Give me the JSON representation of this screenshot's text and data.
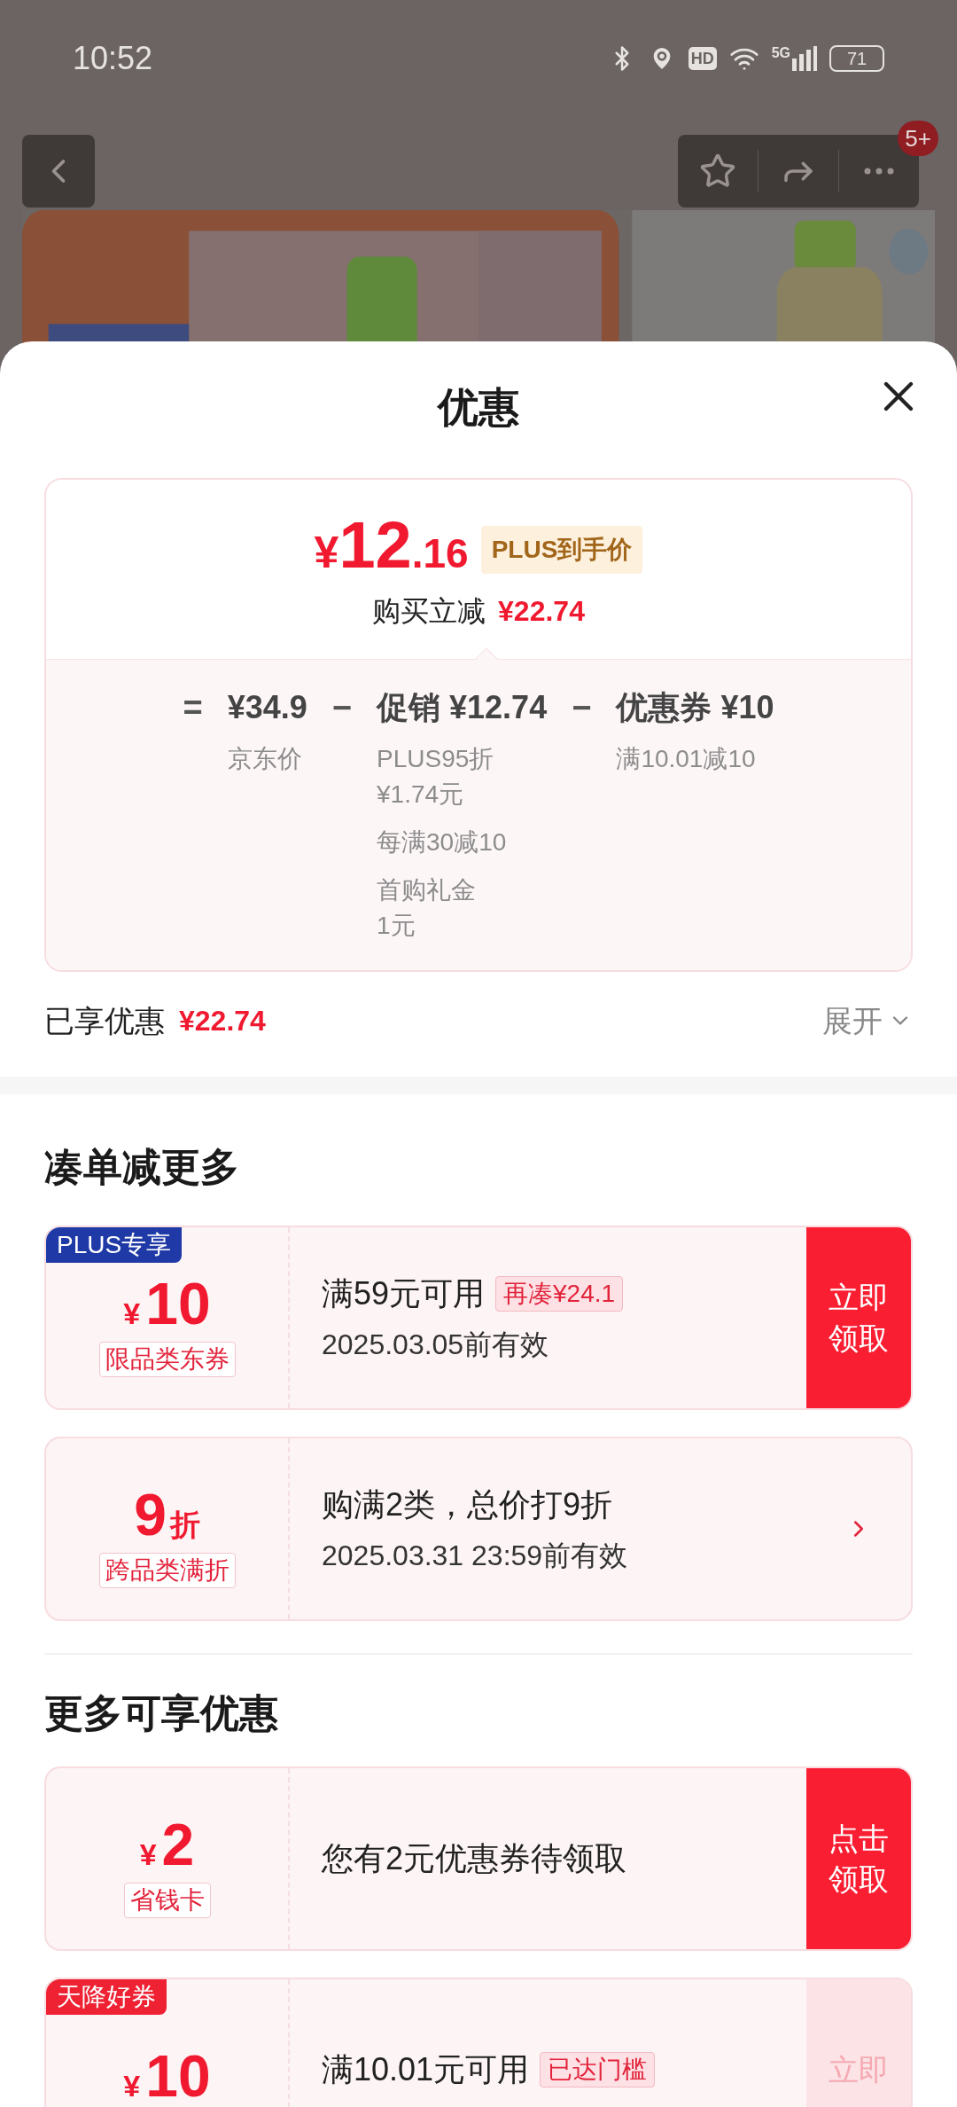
{
  "status_bar": {
    "time": "10:52",
    "hd": "HD",
    "network": "5G",
    "battery": "71"
  },
  "nav": {
    "badge": "5+"
  },
  "sheet": {
    "title": "优惠"
  },
  "price_card": {
    "symbol": "¥",
    "price_int": "12",
    "price_dec": ".16",
    "badge": "PLUS到手价",
    "instant_label": "购买立减",
    "instant_amount": "¥22.74",
    "breakdown": [
      {
        "operator": "=",
        "label": "¥34.9",
        "notes": [
          {
            "lines": [
              "京东价"
            ]
          }
        ]
      },
      {
        "operator": "−",
        "label": "促销 ¥12.74",
        "notes": [
          {
            "lines": [
              "PLUS95折",
              "¥1.74元"
            ]
          },
          {
            "lines": [
              "每满30减10"
            ]
          },
          {
            "lines": [
              "首购礼金",
              "1元"
            ]
          }
        ]
      },
      {
        "operator": "−",
        "label": "优惠券 ¥10",
        "notes": [
          {
            "lines": [
              "满10.01减10"
            ]
          }
        ]
      }
    ]
  },
  "summary": {
    "label": "已享优惠",
    "amount": "¥22.74",
    "expand": "展开"
  },
  "sections": [
    {
      "title": "凑单减更多",
      "coupons": [
        {
          "kind": "button",
          "tag": {
            "text": "PLUS专享",
            "color": "#1f3aa6"
          },
          "symbol": "¥",
          "amount": "10",
          "type": "限品类东券",
          "condition": "满59元可用",
          "hint": "再凑¥24.1",
          "validity": "2025.03.05前有效",
          "button_lines": [
            "立即",
            "领取"
          ],
          "disabled": false
        },
        {
          "kind": "arrow",
          "amount": "9",
          "unit": "折",
          "type": "跨品类满折",
          "condition": "购满2类，总价打9折",
          "validity": "2025.03.31 23:59前有效"
        }
      ]
    },
    {
      "title": "更多可享优惠",
      "coupons": [
        {
          "kind": "button",
          "symbol": "¥",
          "amount": "2",
          "type": "省钱卡",
          "condition": "您有2元优惠券待领取",
          "button_lines": [
            "点击",
            "领取"
          ],
          "disabled": false
        },
        {
          "kind": "button",
          "tag": {
            "text": "天降好券",
            "color": "#ee2233"
          },
          "symbol": "¥",
          "amount": "10",
          "condition": "满10.01元可用",
          "hint": "已达门槛",
          "button_lines": [
            "立即"
          ],
          "disabled": true
        }
      ]
    }
  ]
}
